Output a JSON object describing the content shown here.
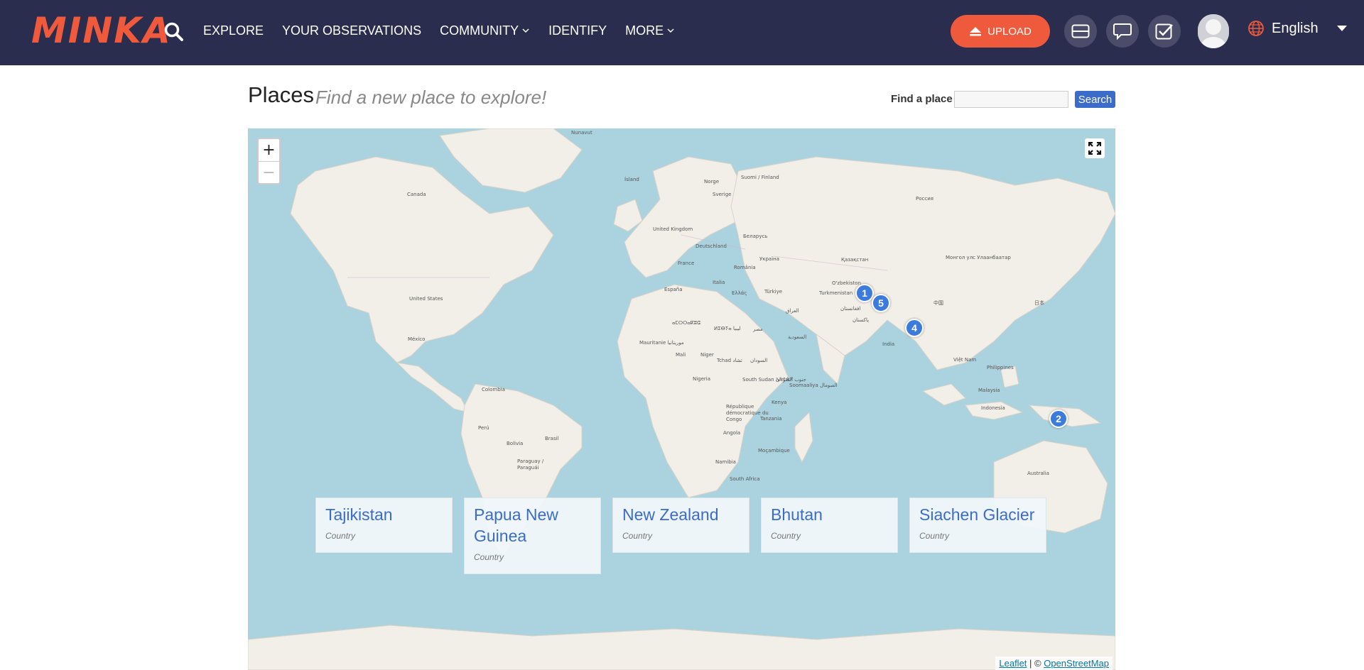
{
  "header": {
    "logo": "MINKA",
    "nav": [
      {
        "label": "EXPLORE",
        "dropdown": false
      },
      {
        "label": "YOUR OBSERVATIONS",
        "dropdown": false
      },
      {
        "label": "COMMUNITY",
        "dropdown": true
      },
      {
        "label": "IDENTIFY",
        "dropdown": false
      },
      {
        "label": "MORE",
        "dropdown": true
      }
    ],
    "upload_label": "UPLOAD",
    "language": "English"
  },
  "colors": {
    "header_bg": "#2b2d4e",
    "accent": "#ef5a3c",
    "link": "#3b6cc9",
    "water": "#aad3df",
    "land": "#f2efe9",
    "marker": "#3b7bdd"
  },
  "page": {
    "title": "Places",
    "subtitle": "Find a new place to explore!",
    "find_label": "Find a place",
    "find_value": "",
    "search_button": "Search"
  },
  "map": {
    "zoom_in": "+",
    "zoom_out": "−",
    "clusters": [
      {
        "count": "1"
      },
      {
        "count": "5"
      },
      {
        "count": "4"
      },
      {
        "count": "2"
      }
    ],
    "labels": [
      "Nunavut",
      "Ísland",
      "Norge",
      "Suomi / Finland",
      "Sverige",
      "Россия",
      "Canada",
      "United Kingdom",
      "Deutschland",
      "Беларусь",
      "France",
      "Україна",
      "România",
      "Қазақстан",
      "Монгол улс Улаанбаатар",
      "España",
      "Italia",
      "Ελλάς",
      "Türkiye",
      "O'zbekiston",
      "Turkmenistan",
      "中国",
      "日本",
      "United States",
      "México",
      "ⴰⵎⵔⵔⴰⴽⵓⵛ",
      "ⵍⵉⴱⵢⴰ ليبيا",
      "مصر",
      "العراق",
      "افغانستان",
      "پاکستان",
      "India",
      "Mauritanie موريتانيا",
      "Mali",
      "Niger",
      "Tchad تشاد",
      "السودان",
      "السعودية",
      "Việt Nam",
      "Philippines",
      "Nigeria",
      "South Sudan جنوب السودان",
      "ኢትዮጵያ",
      "Soomaaliya الصومال",
      "Malaysia",
      "Colombia",
      "République démocratique du Congo",
      "Kenya",
      "Indonesia",
      "Perú",
      "Brasil",
      "Tanzania",
      "Bolivia",
      "Angola",
      "Paraguay / Paraguái",
      "Moçambique",
      "Namibia",
      "South Africa",
      "Australia"
    ],
    "attribution_leaflet": "Leaflet",
    "attribution_sep": " | © ",
    "attribution_osm": "OpenStreetMap"
  },
  "places": [
    {
      "name": "Tajikistan",
      "type": "Country"
    },
    {
      "name": "Papua New Guinea",
      "type": "Country"
    },
    {
      "name": "New Zealand",
      "type": "Country"
    },
    {
      "name": "Bhutan",
      "type": "Country"
    },
    {
      "name": "Siachen Glacier",
      "type": "Country"
    }
  ]
}
